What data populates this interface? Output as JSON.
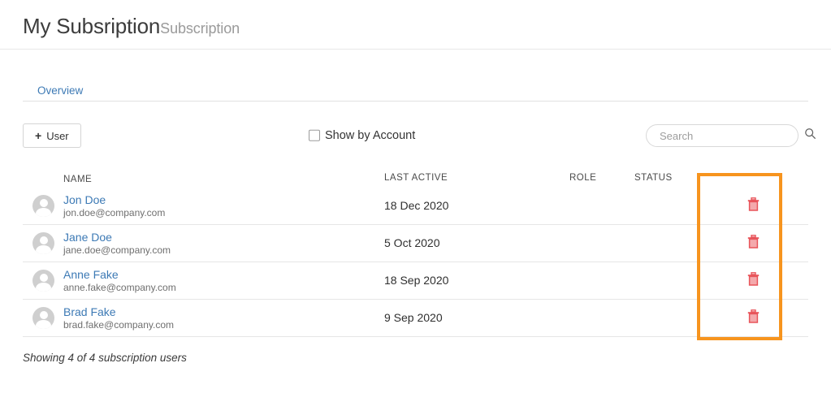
{
  "header": {
    "title_main": "My Subsription",
    "title_suffix": "Subscription"
  },
  "tabs": [
    {
      "label": "Overview",
      "active": true
    }
  ],
  "toolbar": {
    "add_user_label": "User",
    "add_user_plus": "+",
    "show_by_account_label": "Show by Account",
    "show_by_account_checked": false,
    "search_placeholder": "Search",
    "search_value": "",
    "search_icon": "search-icon"
  },
  "table": {
    "columns": [
      "NAME",
      "LAST ACTIVE",
      "ROLE",
      "STATUS"
    ],
    "rows": [
      {
        "name": "Jon Doe",
        "email": "jon.doe@company.com",
        "last_active": "18 Dec 2020",
        "role": "",
        "status": "",
        "delete_icon": "trash-icon"
      },
      {
        "name": "Jane Doe",
        "email": "jane.doe@company.com",
        "last_active": "5 Oct 2020",
        "role": "",
        "status": "",
        "delete_icon": "trash-icon"
      },
      {
        "name": "Anne Fake",
        "email": "anne.fake@company.com",
        "last_active": "18 Sep 2020",
        "role": "",
        "status": "",
        "delete_icon": "trash-icon"
      },
      {
        "name": "Brad Fake",
        "email": "brad.fake@company.com",
        "last_active": "9 Sep 2020",
        "role": "",
        "status": "",
        "delete_icon": "trash-icon"
      }
    ]
  },
  "footer": {
    "summary": "Showing 4 of 4 subscription users"
  },
  "colors": {
    "link": "#3d7ab5",
    "highlight": "#f7941e",
    "trash": "#e8545a",
    "trash_fill": "#f4a9ac",
    "title": "#3c3c3c",
    "title_suffix": "#9a9a9a"
  }
}
